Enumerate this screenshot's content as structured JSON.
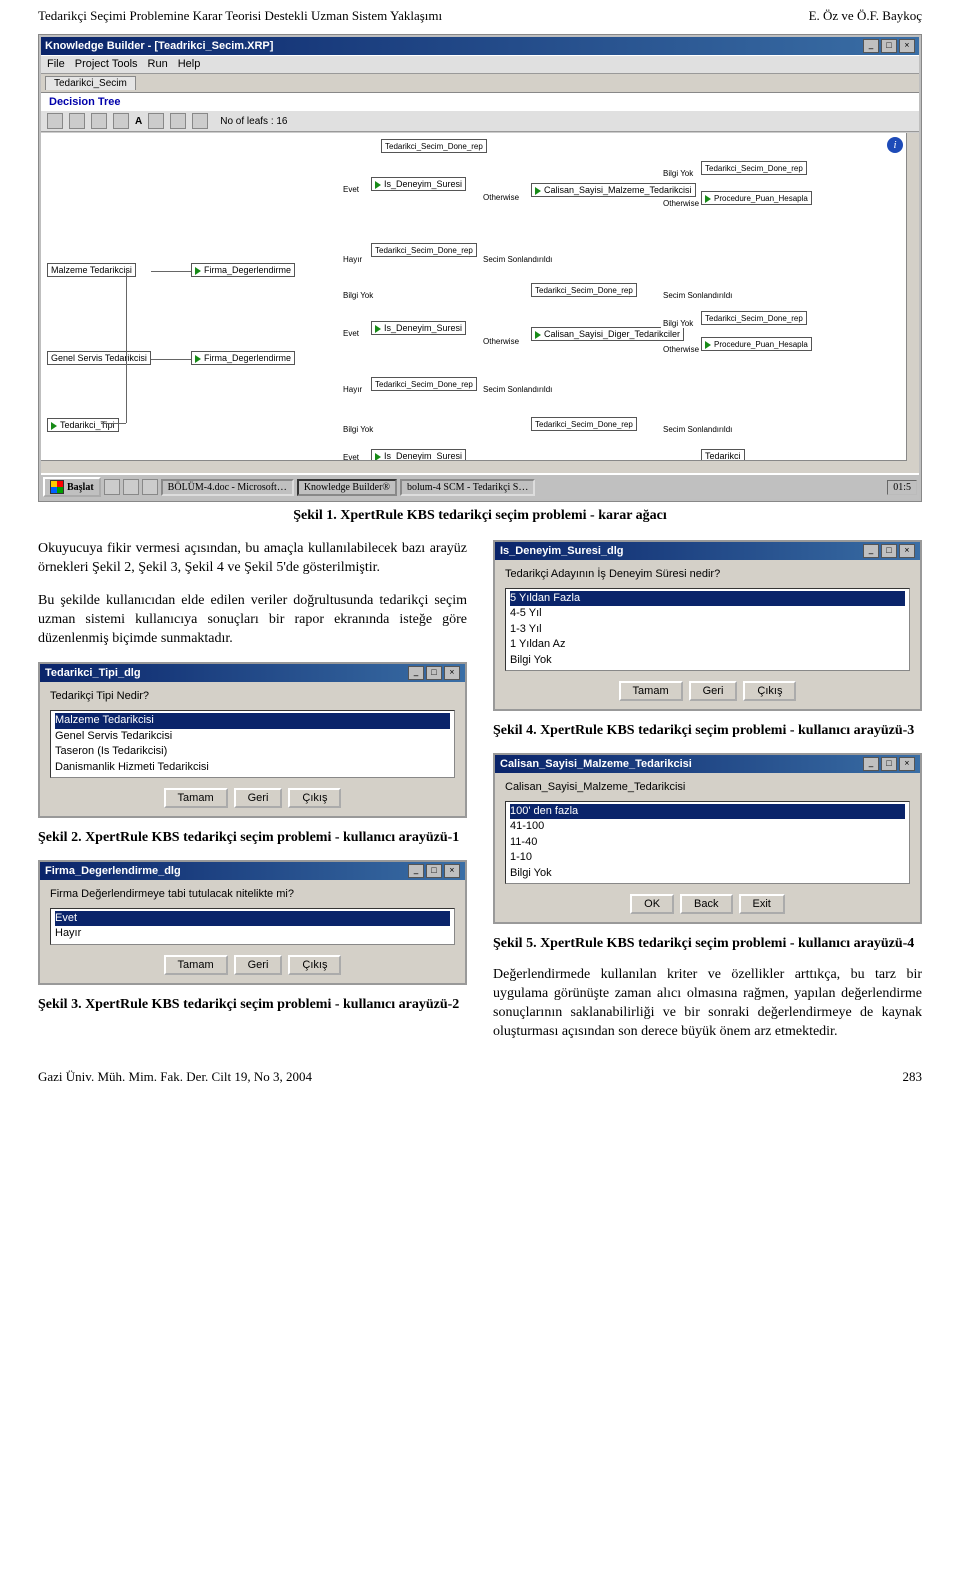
{
  "header": {
    "left": "Tedarikçi Seçimi Problemine Karar Teorisi Destekli Uzman Sistem Yaklaşımı",
    "right": "E. Öz  ve Ö.F. Baykoç"
  },
  "main_screenshot": {
    "window_title": "Knowledge Builder - [Teadrikci_Secim.XRP]",
    "menus": [
      "File",
      "Project Tools",
      "Run",
      "Help"
    ],
    "tab": "Tedarikci_Secim",
    "section": "Decision Tree",
    "leaf_info": "No of leafs : 16",
    "info_icon": "i",
    "tree": {
      "root": "Tedarikci_Tipi",
      "branch1_label": "Malzeme Tedarikcisi",
      "branch2_label": "Genel Servis Tedarikcisi",
      "firma": "Firma_Degerlendirme",
      "evet": "Evet",
      "hayir": "Hayır",
      "otherwise": "Otherwise",
      "bilgi_yok": "Bilgi Yok",
      "is_deneyim": "Is_Deneyim_Suresi",
      "calisan_malzeme": "Calisan_Sayisi_Malzeme_Tedarikcisi",
      "calisan_diger": "Calisan_Sayisi_Diger_Tedarikciler",
      "sdone": "Tedarikci_Secim_Done_rep",
      "proc": "Procedure_Puan_Hesapla",
      "sonland": "Secim Sonlandırıldı",
      "tedarikci": "Tedarikci"
    },
    "taskbar": {
      "start": "Başlat",
      "items": [
        "BÖLÜM-4.doc - Microsoft…",
        "Knowledge Builder®",
        "bolum-4 SCM - Tedarikçi S…"
      ],
      "time": "01:5"
    }
  },
  "caption1": "Şekil 1. XpertRule KBS tedarikçi seçim problemi - karar ağacı",
  "para1": "Okuyucuya fikir vermesi açısından, bu amaçla kullanılabilecek bazı arayüz örnekleri Şekil 2, Şekil 3, Şekil 4 ve Şekil 5'de gösterilmiştir.",
  "para2": "Bu şekilde kullanıcıdan elde edilen veriler doğrultusunda tedarikçi seçim uzman sistemi kullanıcıya sonuçları bir rapor ekranında isteğe göre düzenlenmiş biçimde sunmaktadır.",
  "dlg2": {
    "title": "Tedarikci_Tipi_dlg",
    "prompt": "Tedarikçi Tipi Nedir?",
    "options": [
      "Malzeme Tedarikcisi",
      "Genel Servis Tedarikcisi",
      "Taseron (Is Tedarikcisi)",
      "Danismanlik Hizmeti Tedarikcisi"
    ],
    "btns": [
      "Tamam",
      "Geri",
      "Çıkış"
    ]
  },
  "dlg3": {
    "title": "Firma_Degerlendirme_dlg",
    "prompt": "Firma Değerlendirmeye tabi tutulacak nitelikte mi?",
    "options": [
      "Evet",
      "Hayır"
    ],
    "btns": [
      "Tamam",
      "Geri",
      "Çıkış"
    ]
  },
  "dlg4": {
    "title": "Is_Deneyim_Suresi_dlg",
    "prompt": "Tedarikçi Adayının İş Deneyim Süresi nedir?",
    "options": [
      "5 Yıldan Fazla",
      "4-5 Yıl",
      "1-3 Yıl",
      "1 Yıldan Az",
      "Bilgi Yok"
    ],
    "btns": [
      "Tamam",
      "Geri",
      "Çıkış"
    ]
  },
  "dlg5": {
    "title": "Calisan_Sayisi_Malzeme_Tedarikcisi",
    "prompt": "Calisan_Sayisi_Malzeme_Tedarikcisi",
    "options": [
      "100' den fazla",
      "41-100",
      "11-40",
      "1-10",
      "Bilgi Yok"
    ],
    "btns": [
      "OK",
      "Back",
      "Exit"
    ]
  },
  "cap2": "Şekil 2. XpertRule KBS tedarikçi seçim problemi - kullanıcı arayüzü-1",
  "cap3": "Şekil 3. XpertRule KBS tedarikçi seçim problemi - kullanıcı arayüzü-2",
  "cap4": "Şekil 4. XpertRule KBS tedarikçi seçim problemi - kullanıcı arayüzü-3",
  "cap5": "Şekil 5. XpertRule KBS tedarikçi seçim problemi - kullanıcı arayüzü-4",
  "para3": "Değerlendirmede kullanılan kriter ve özellikler arttıkça, bu tarz bir uygulama görünüşte zaman alıcı olmasına rağmen, yapılan değerlendirme sonuçlarının saklanabilirliği ve bir sonraki değerlendirmeye de kaynak oluşturması açısından son derece büyük önem arz etmektedir.",
  "footer": {
    "left": "Gazi Üniv. Müh. Mim. Fak. Der. Cilt 19, No 3, 2004",
    "right": "283"
  }
}
